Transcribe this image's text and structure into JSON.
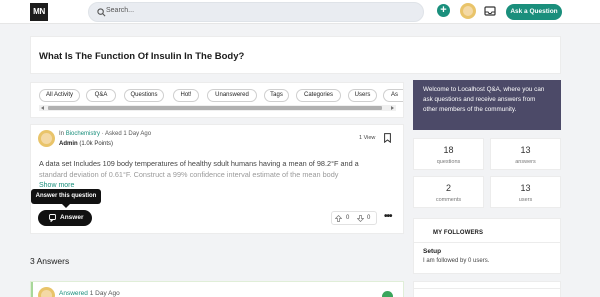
{
  "header": {
    "logo_text": "MN",
    "search_placeholder": "Search...",
    "ask_button": "Ask a Question",
    "colors": {
      "accent": "#1a8f7c",
      "welcome_bg": "#4c4a68"
    }
  },
  "question": {
    "title": "What Is The Function Of Insulin In The Body?",
    "meta_prefix": "In",
    "category": "Biochemistry",
    "asked": "Asked 1 Day Ago",
    "author_name": "Admin",
    "author_points": "(1.0k Points)",
    "views": "1 View",
    "body_line1": "A data set Includes 109 body temperatures of healthy sdult humans having a mean of 98.2°F and a",
    "body_line2": "standard deviation of 0.61°F. Construct a 99% confidence interval estimate of the mean body",
    "show_more": "Show more",
    "tooltip": "Answer this question",
    "answer_button": "Answer",
    "upvotes": "0",
    "downvotes": "0"
  },
  "tabs": [
    "All Activity",
    "Q&A",
    "Questions",
    "Hot!",
    "Unanswered",
    "Tags",
    "Categories",
    "Users",
    "As"
  ],
  "answers": {
    "count_label": "3 Answers",
    "first_meta": "Answered",
    "first_time": "1 Day Ago"
  },
  "sidebar": {
    "welcome": "Welcome to Localhost Q&A, where you can ask questions and receive answers from other members of the community.",
    "stats": [
      {
        "num": "18",
        "label": "questions"
      },
      {
        "num": "13",
        "label": "answers"
      },
      {
        "num": "2",
        "label": "comments"
      },
      {
        "num": "13",
        "label": "users"
      }
    ],
    "followers_title": "MY FOLLOWERS",
    "followers_name": "Setup",
    "followers_text": "I am followed by 0 users."
  }
}
